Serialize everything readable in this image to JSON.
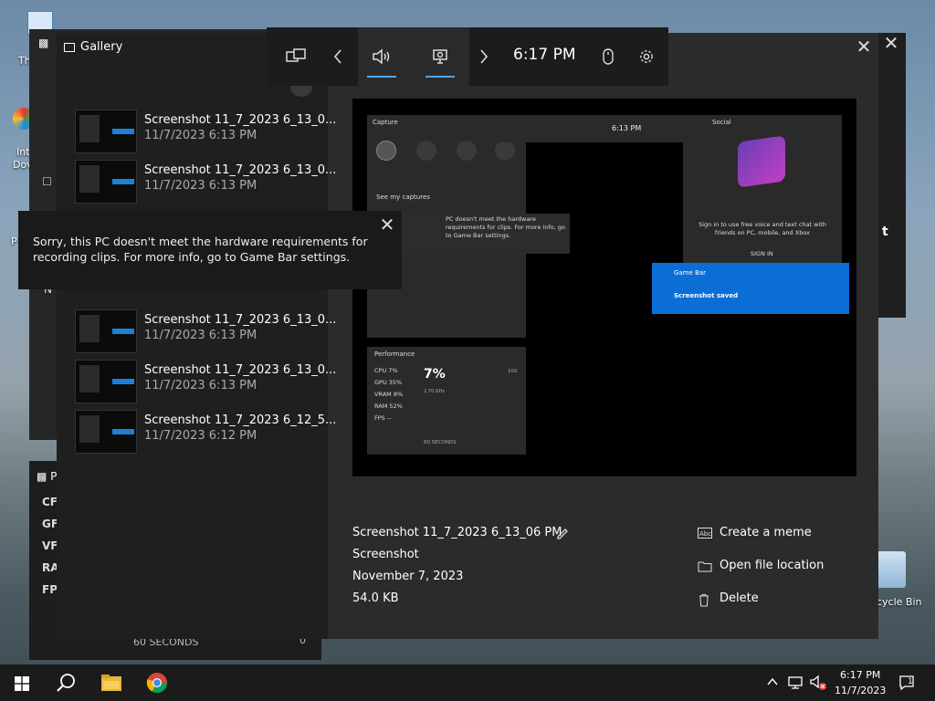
{
  "desktop": {
    "labels": [
      "Thi",
      "Int",
      "Dov",
      "P",
      "t",
      "cycle Bin"
    ]
  },
  "back_panel": {
    "title_fragment": "N",
    "perf_fragment": "P",
    "perf_rows": [
      "CF",
      "GF",
      "VF",
      "RA",
      "FP"
    ],
    "footer_seconds": "60 SECONDS",
    "footer_zero": "0"
  },
  "gallery": {
    "title": "Gallery",
    "items": [
      {
        "name": "Screenshot 11_7_2023 6_13_0...",
        "date": "11/7/2023 6:13 PM"
      },
      {
        "name": "Screenshot 11_7_2023 6_13_0...",
        "date": "11/7/2023 6:13 PM"
      },
      {
        "name": "Screenshot 11_7_2023 6_13_0...",
        "date": "11/7/2023 6:13 PM"
      },
      {
        "name": "Screenshot 11_7_2023 6_13_0...",
        "date": "11/7/2023 6:13 PM"
      },
      {
        "name": "Screenshot 11_7_2023 6_12_5...",
        "date": "11/7/2023 6:12 PM"
      }
    ],
    "details": {
      "filename": "Screenshot 11_7_2023 6_13_06 PM",
      "type": "Screenshot",
      "date": "November 7, 2023",
      "size": "54.0 KB"
    },
    "actions": {
      "meme": "Create a meme",
      "open": "Open file location",
      "delete": "Delete"
    },
    "preview": {
      "capture_title": "Capture",
      "see_captures": "See my captures",
      "toolbar_time": "6:13 PM",
      "social_title": "Social",
      "social_text": "Sign in to use free voice and text chat with friends on PC, mobile, and Xbox",
      "sign_in": "SIGN IN",
      "toast_text": "PC doesn't meet the hardware requirements for clips. For more info, go to Game Bar settings.",
      "gamebar_toast_title": "Game Bar",
      "gamebar_toast_msg": "Screenshot saved",
      "perf_title": "Performance",
      "perf_rows": [
        "CPU  7%",
        "GPU  35%",
        "VRAM  8%",
        "RAM  52%",
        "FPS  --"
      ],
      "perf_big": "7%",
      "perf_sub": "2.70 GHz",
      "perf_hundred": "100",
      "perf_seconds": "60 SECONDS",
      "perf_zero": "0"
    }
  },
  "gamebar": {
    "time": "6:17 PM"
  },
  "toast": {
    "message": "Sorry, this PC doesn't meet the hardware requirements for recording clips. For more info, go to Game Bar settings."
  },
  "taskbar": {
    "time": "6:17 PM",
    "date": "11/7/2023",
    "notif_count": "1"
  }
}
